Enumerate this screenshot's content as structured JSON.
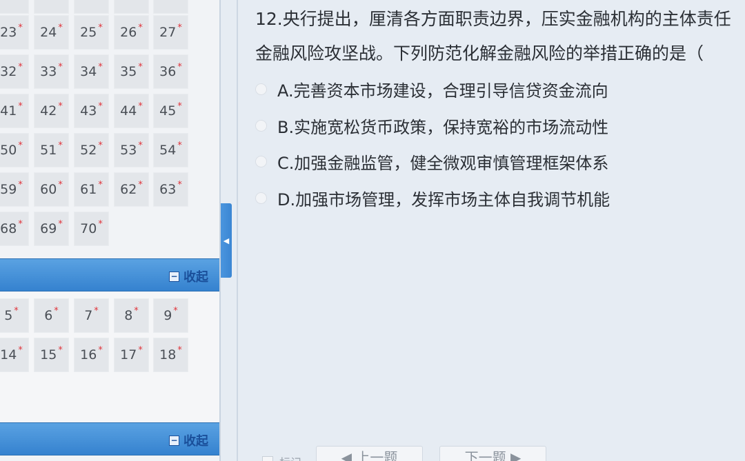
{
  "navigator": {
    "section1": {
      "rows": [
        [
          {
            "n": "23"
          },
          {
            "n": "24"
          },
          {
            "n": "25"
          },
          {
            "n": "26"
          },
          {
            "n": "27"
          }
        ],
        [
          {
            "n": "32"
          },
          {
            "n": "33"
          },
          {
            "n": "34"
          },
          {
            "n": "35"
          },
          {
            "n": "36"
          }
        ],
        [
          {
            "n": "41"
          },
          {
            "n": "42"
          },
          {
            "n": "43"
          },
          {
            "n": "44"
          },
          {
            "n": "45"
          }
        ],
        [
          {
            "n": "50"
          },
          {
            "n": "51"
          },
          {
            "n": "52"
          },
          {
            "n": "53"
          },
          {
            "n": "54"
          }
        ],
        [
          {
            "n": "59"
          },
          {
            "n": "60"
          },
          {
            "n": "61"
          },
          {
            "n": "62"
          },
          {
            "n": "63"
          }
        ],
        [
          {
            "n": "68"
          },
          {
            "n": "69"
          },
          {
            "n": "70"
          }
        ]
      ]
    },
    "section2": {
      "collapse_label": "收起",
      "rows": [
        [
          {
            "n": "5"
          },
          {
            "n": "6"
          },
          {
            "n": "7"
          },
          {
            "n": "8"
          },
          {
            "n": "9"
          }
        ],
        [
          {
            "n": "14"
          },
          {
            "n": "15"
          },
          {
            "n": "16"
          },
          {
            "n": "17"
          },
          {
            "n": "18"
          }
        ]
      ]
    },
    "section3": {
      "collapse_label": "收起"
    },
    "star": "*",
    "collapse_glyph": "−"
  },
  "splitter": {
    "glyph": "◀"
  },
  "question": {
    "line1": "12.央行提出，厘清各方面职责边界，压实金融机构的主体责任",
    "line2": "金融风险攻坚战。下列防范化解金融风险的举措正确的是（",
    "options": [
      {
        "label": "A.完善资本市场建设，合理引导信贷资金流向"
      },
      {
        "label": "B.实施宽松货币政策，保持宽裕的市场流动性"
      },
      {
        "label": "C.加强金融监管，健全微观审慎管理框架体系"
      },
      {
        "label": "D.加强市场管理，发挥市场主体自我调节机能"
      }
    ]
  },
  "footer": {
    "mark_label": "标记",
    "prev_label": "◀ 上一题",
    "next_label": "下一题 ▶"
  }
}
